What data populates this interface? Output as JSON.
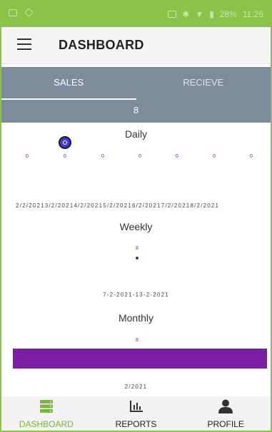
{
  "status_bar": {
    "battery": "28%",
    "time": "11:26"
  },
  "app_bar": {
    "menu_icon": "hamburger-menu-icon",
    "title": "DASHBOARD"
  },
  "tabs": [
    {
      "label": "SALES",
      "active": true
    },
    {
      "label": "RECIEVE",
      "active": false
    }
  ],
  "count_bar": {
    "value": "8"
  },
  "colors": {
    "accent_green": "#8bc34a",
    "tab_bar": "#7d8c9c",
    "chart_purple": "#7b1fa2",
    "selected_point": "#3d3bd9"
  },
  "chart_data": [
    {
      "type": "line",
      "title": "Daily",
      "x": [
        "2/2/2021",
        "3/2/2021",
        "4/2/2021",
        "5/2/2021",
        "6/2/2021",
        "7/2/2021",
        "8/2/2021"
      ],
      "series": [
        {
          "values": [
            0,
            0,
            0,
            0,
            0,
            0,
            0
          ]
        }
      ],
      "value_labels": [
        "0",
        "0",
        "0",
        "0",
        "0",
        "0",
        "0"
      ],
      "x_axis_text": "2/2/20213/2/20214/2/20215/2/20216/2/20217/2/20218/2/2021",
      "selected_index": 1
    },
    {
      "type": "scatter",
      "title": "Weekly",
      "x": [
        "7-2-2021-13-2-2021"
      ],
      "series": [
        {
          "values": [
            8
          ]
        }
      ],
      "value_labels": [
        "8"
      ]
    },
    {
      "type": "bar",
      "title": "Monthly",
      "categories": [
        "2/2021"
      ],
      "values": [
        8
      ],
      "value_labels": [
        "8"
      ]
    }
  ],
  "bottom_nav": [
    {
      "label": "DASHBOARD",
      "icon": "server-stack-icon",
      "active": true
    },
    {
      "label": "REPORTS",
      "icon": "bar-chart-icon",
      "active": false
    },
    {
      "label": "PROFILE",
      "icon": "person-icon",
      "active": false
    }
  ]
}
